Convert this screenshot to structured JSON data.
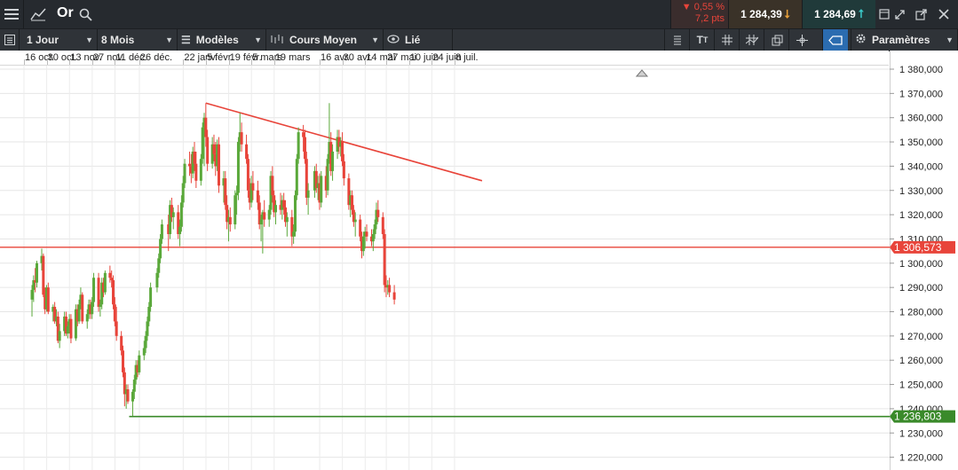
{
  "header": {
    "instrument": "Or",
    "change_pct": "▼ 0,55 %",
    "change_pts": "7,2 pts",
    "bid": "1 284,39",
    "ask": "1 284,69"
  },
  "toolbar": {
    "period": "1 Jour",
    "range": "8 Mois",
    "models": "Modèles",
    "price_type": "Cours Moyen",
    "linked": "Lié",
    "settings": "Paramètres"
  },
  "icons": [
    "menu-icon",
    "line-chart-icon",
    "search-icon",
    "popout-icon",
    "arrows-icon",
    "external-icon",
    "close-icon",
    "sidebar-toggle-icon",
    "models-icon",
    "price-type-icon",
    "eye-icon",
    "list-icon",
    "text-icon",
    "grid-icon",
    "indicators-icon",
    "layers-icon",
    "crosshair-icon",
    "label-icon",
    "gear-icon"
  ],
  "dates": [
    "16 oct.",
    "30 oct.",
    "13 nov.",
    "27 nov.",
    "11 déc.",
    "26 déc.",
    "22 janv.",
    "5 févr.",
    "19 févr.",
    "5 mars",
    "19 mars",
    "16 avr.",
    "30 avr.",
    "14 mai",
    "27 mai",
    "10 juin",
    "24 juin",
    "8 juil."
  ],
  "price_labels": [
    "1 380,000",
    "1 370,000",
    "1 360,000",
    "1 350,000",
    "1 340,000",
    "1 330,000",
    "1 320,000",
    "1 310,000",
    "1 300,000",
    "1 290,000",
    "1 280,000",
    "1 270,000",
    "1 260,000",
    "1 250,000",
    "1 240,000",
    "1 230,000",
    "1 220,000"
  ],
  "levels": {
    "resistance_label": "1 306,573",
    "support_label": "1 236,803",
    "resistance_color": "#e8443a",
    "support_color": "#3a8a2a"
  },
  "colors": {
    "up": "#5aa83a",
    "down": "#e8443a"
  },
  "chart_data": {
    "type": "candlestick",
    "period": "1 Jour",
    "ylim": [
      1215,
      1382
    ],
    "horizontal_lines": [
      1306.573,
      1236.803
    ],
    "trendline": {
      "from": [
        "2018-01-25",
        1366
      ],
      "to": [
        "2018-07-14",
        1334
      ]
    },
    "candles": [
      [
        "2017-10-10",
        1285,
        1291,
        1278,
        1289
      ],
      [
        "2017-10-11",
        1289,
        1295,
        1284,
        1293
      ],
      [
        "2017-10-12",
        1293,
        1298,
        1288,
        1292
      ],
      [
        "2017-10-13",
        1292,
        1301,
        1290,
        1300
      ],
      [
        "2017-10-16",
        1300,
        1306,
        1297,
        1303
      ],
      [
        "2017-10-17",
        1303,
        1304,
        1286,
        1287
      ],
      [
        "2017-10-18",
        1287,
        1290,
        1279,
        1281
      ],
      [
        "2017-10-19",
        1281,
        1291,
        1280,
        1290
      ],
      [
        "2017-10-20",
        1290,
        1292,
        1279,
        1280
      ],
      [
        "2017-10-23",
        1280,
        1283,
        1276,
        1282
      ],
      [
        "2017-10-24",
        1282,
        1284,
        1275,
        1276
      ],
      [
        "2017-10-25",
        1276,
        1281,
        1274,
        1278
      ],
      [
        "2017-10-26",
        1278,
        1280,
        1267,
        1268
      ],
      [
        "2017-10-27",
        1268,
        1275,
        1265,
        1272
      ],
      [
        "2017-10-30",
        1272,
        1280,
        1270,
        1278
      ],
      [
        "2017-10-31",
        1278,
        1280,
        1270,
        1271
      ],
      [
        "2017-11-01",
        1271,
        1276,
        1269,
        1274
      ],
      [
        "2017-11-02",
        1274,
        1279,
        1271,
        1277
      ],
      [
        "2017-11-03",
        1277,
        1279,
        1267,
        1269
      ],
      [
        "2017-11-06",
        1269,
        1283,
        1268,
        1281
      ],
      [
        "2017-11-07",
        1281,
        1283,
        1274,
        1276
      ],
      [
        "2017-11-08",
        1276,
        1285,
        1275,
        1283
      ],
      [
        "2017-11-09",
        1283,
        1290,
        1281,
        1287
      ],
      [
        "2017-11-10",
        1287,
        1288,
        1275,
        1276
      ],
      [
        "2017-11-13",
        1276,
        1281,
        1273,
        1279
      ],
      [
        "2017-11-14",
        1279,
        1285,
        1277,
        1283
      ],
      [
        "2017-11-15",
        1283,
        1285,
        1277,
        1279
      ],
      [
        "2017-11-16",
        1279,
        1286,
        1277,
        1284
      ],
      [
        "2017-11-17",
        1284,
        1296,
        1282,
        1294
      ],
      [
        "2017-11-20",
        1294,
        1296,
        1280,
        1282
      ],
      [
        "2017-11-21",
        1282,
        1285,
        1278,
        1283
      ],
      [
        "2017-11-22",
        1283,
        1294,
        1281,
        1292
      ],
      [
        "2017-11-23",
        1292,
        1294,
        1286,
        1288
      ],
      [
        "2017-11-24",
        1288,
        1297,
        1287,
        1296
      ],
      [
        "2017-11-27",
        1296,
        1299,
        1292,
        1294
      ],
      [
        "2017-11-28",
        1294,
        1297,
        1290,
        1293
      ],
      [
        "2017-11-29",
        1293,
        1295,
        1281,
        1283
      ],
      [
        "2017-11-30",
        1283,
        1286,
        1274,
        1276
      ],
      [
        "2017-12-01",
        1276,
        1282,
        1268,
        1270
      ],
      [
        "2017-12-04",
        1270,
        1272,
        1262,
        1264
      ],
      [
        "2017-12-05",
        1264,
        1266,
        1253,
        1255
      ],
      [
        "2017-12-06",
        1255,
        1257,
        1241,
        1246
      ],
      [
        "2017-12-07",
        1246,
        1250,
        1240,
        1248
      ],
      [
        "2017-12-08",
        1248,
        1250,
        1242,
        1243
      ],
      [
        "2017-12-11",
        1243,
        1248,
        1237,
        1247
      ],
      [
        "2017-12-12",
        1247,
        1254,
        1244,
        1252
      ],
      [
        "2017-12-13",
        1252,
        1260,
        1250,
        1258
      ],
      [
        "2017-12-14",
        1258,
        1260,
        1253,
        1255
      ],
      [
        "2017-12-15",
        1255,
        1264,
        1254,
        1262
      ],
      [
        "2017-12-18",
        1262,
        1268,
        1260,
        1265
      ],
      [
        "2017-12-19",
        1265,
        1272,
        1263,
        1270
      ],
      [
        "2017-12-20",
        1270,
        1278,
        1268,
        1276
      ],
      [
        "2017-12-21",
        1276,
        1284,
        1274,
        1282
      ],
      [
        "2017-12-22",
        1282,
        1292,
        1280,
        1290
      ],
      [
        "2017-12-26",
        1290,
        1298,
        1288,
        1296
      ],
      [
        "2017-12-27",
        1296,
        1304,
        1294,
        1302
      ],
      [
        "2017-12-28",
        1302,
        1312,
        1300,
        1310
      ],
      [
        "2017-12-29",
        1310,
        1318,
        1308,
        1316
      ],
      [
        "2018-01-02",
        1316,
        1320,
        1305,
        1312
      ],
      [
        "2018-01-03",
        1312,
        1326,
        1310,
        1324
      ],
      [
        "2018-01-04",
        1324,
        1327,
        1317,
        1319
      ],
      [
        "2018-01-05",
        1319,
        1323,
        1314,
        1321
      ],
      [
        "2018-01-08",
        1321,
        1324,
        1310,
        1312
      ],
      [
        "2018-01-09",
        1312,
        1318,
        1307,
        1315
      ],
      [
        "2018-01-10",
        1315,
        1328,
        1313,
        1325
      ],
      [
        "2018-01-11",
        1325,
        1336,
        1323,
        1333
      ],
      [
        "2018-01-12",
        1333,
        1343,
        1331,
        1341
      ],
      [
        "2018-01-15",
        1341,
        1346,
        1336,
        1340
      ],
      [
        "2018-01-16",
        1340,
        1345,
        1333,
        1337
      ],
      [
        "2018-01-17",
        1337,
        1348,
        1335,
        1346
      ],
      [
        "2018-01-18",
        1346,
        1350,
        1338,
        1341
      ],
      [
        "2018-01-19",
        1341,
        1346,
        1331,
        1334
      ],
      [
        "2018-01-22",
        1334,
        1345,
        1332,
        1343
      ],
      [
        "2018-01-23",
        1343,
        1358,
        1341,
        1356
      ],
      [
        "2018-01-24",
        1356,
        1362,
        1340,
        1360
      ],
      [
        "2018-01-25",
        1360,
        1366,
        1348,
        1352
      ],
      [
        "2018-01-26",
        1352,
        1355,
        1338,
        1341
      ],
      [
        "2018-01-29",
        1341,
        1352,
        1339,
        1349
      ],
      [
        "2018-01-30",
        1349,
        1353,
        1342,
        1345
      ],
      [
        "2018-01-31",
        1345,
        1350,
        1336,
        1340
      ],
      [
        "2018-02-01",
        1340,
        1351,
        1338,
        1349
      ],
      [
        "2018-02-02",
        1349,
        1352,
        1329,
        1332
      ],
      [
        "2018-02-05",
        1332,
        1338,
        1325,
        1335
      ],
      [
        "2018-02-06",
        1335,
        1338,
        1322,
        1324
      ],
      [
        "2018-02-07",
        1324,
        1328,
        1314,
        1317
      ],
      [
        "2018-02-08",
        1317,
        1322,
        1309,
        1319
      ],
      [
        "2018-02-09",
        1319,
        1323,
        1313,
        1316
      ],
      [
        "2018-02-12",
        1316,
        1330,
        1314,
        1328
      ],
      [
        "2018-02-13",
        1328,
        1332,
        1320,
        1329
      ],
      [
        "2018-02-14",
        1329,
        1352,
        1326,
        1350
      ],
      [
        "2018-02-15",
        1350,
        1362,
        1346,
        1354
      ],
      [
        "2018-02-16",
        1354,
        1358,
        1346,
        1349
      ],
      [
        "2018-02-19",
        1349,
        1353,
        1341,
        1343
      ],
      [
        "2018-02-20",
        1343,
        1345,
        1327,
        1330
      ],
      [
        "2018-02-21",
        1330,
        1335,
        1322,
        1325
      ],
      [
        "2018-02-22",
        1325,
        1336,
        1323,
        1333
      ],
      [
        "2018-02-23",
        1333,
        1338,
        1326,
        1330
      ],
      [
        "2018-02-26",
        1330,
        1334,
        1322,
        1325
      ],
      [
        "2018-02-27",
        1325,
        1328,
        1314,
        1316
      ],
      [
        "2018-02-28",
        1316,
        1320,
        1309,
        1318
      ],
      [
        "2018-03-01",
        1318,
        1322,
        1304,
        1321
      ],
      [
        "2018-03-02",
        1321,
        1326,
        1315,
        1318
      ],
      [
        "2018-03-05",
        1318,
        1324,
        1315,
        1322
      ],
      [
        "2018-03-06",
        1322,
        1338,
        1320,
        1336
      ],
      [
        "2018-03-07",
        1336,
        1340,
        1325,
        1328
      ],
      [
        "2018-03-08",
        1328,
        1330,
        1319,
        1321
      ],
      [
        "2018-03-09",
        1321,
        1326,
        1316,
        1324
      ],
      [
        "2018-03-12",
        1324,
        1329,
        1320,
        1322
      ],
      [
        "2018-03-13",
        1322,
        1328,
        1318,
        1326
      ],
      [
        "2018-03-14",
        1326,
        1329,
        1320,
        1323
      ],
      [
        "2018-03-15",
        1323,
        1326,
        1315,
        1317
      ],
      [
        "2018-03-16",
        1317,
        1321,
        1311,
        1319
      ],
      [
        "2018-03-19",
        1319,
        1322,
        1307,
        1311
      ],
      [
        "2018-03-20",
        1311,
        1316,
        1308,
        1313
      ],
      [
        "2018-03-21",
        1313,
        1330,
        1311,
        1328
      ],
      [
        "2018-03-22",
        1328,
        1345,
        1326,
        1343
      ],
      [
        "2018-03-23",
        1343,
        1356,
        1341,
        1354
      ],
      [
        "2018-03-26",
        1354,
        1357,
        1346,
        1352
      ],
      [
        "2018-03-27",
        1352,
        1355,
        1341,
        1343
      ],
      [
        "2018-03-28",
        1343,
        1346,
        1324,
        1327
      ],
      [
        "2018-03-29",
        1327,
        1333,
        1320,
        1330
      ],
      [
        "2018-04-02",
        1330,
        1340,
        1327,
        1338
      ],
      [
        "2018-04-03",
        1338,
        1341,
        1329,
        1331
      ],
      [
        "2018-04-04",
        1331,
        1336,
        1326,
        1333
      ],
      [
        "2018-04-05",
        1333,
        1337,
        1322,
        1325
      ],
      [
        "2018-04-06",
        1325,
        1338,
        1323,
        1336
      ],
      [
        "2018-04-09",
        1336,
        1340,
        1327,
        1330
      ],
      [
        "2018-04-10",
        1330,
        1345,
        1328,
        1343
      ],
      [
        "2018-04-11",
        1343,
        1366,
        1341,
        1350
      ],
      [
        "2018-04-12",
        1350,
        1354,
        1336,
        1338
      ],
      [
        "2018-04-13",
        1338,
        1349,
        1334,
        1346
      ],
      [
        "2018-04-16",
        1346,
        1355,
        1343,
        1352
      ],
      [
        "2018-04-17",
        1352,
        1355,
        1345,
        1348
      ],
      [
        "2018-04-18",
        1348,
        1352,
        1344,
        1350
      ],
      [
        "2018-04-19",
        1350,
        1354,
        1340,
        1342
      ],
      [
        "2018-04-20",
        1342,
        1345,
        1332,
        1335
      ],
      [
        "2018-04-23",
        1335,
        1337,
        1322,
        1324
      ],
      [
        "2018-04-24",
        1324,
        1330,
        1319,
        1328
      ],
      [
        "2018-04-25",
        1328,
        1330,
        1320,
        1322
      ],
      [
        "2018-04-26",
        1322,
        1324,
        1315,
        1317
      ],
      [
        "2018-04-27",
        1317,
        1321,
        1311,
        1318
      ],
      [
        "2018-04-30",
        1318,
        1320,
        1309,
        1311
      ],
      [
        "2018-05-01",
        1311,
        1313,
        1302,
        1305
      ],
      [
        "2018-05-02",
        1305,
        1313,
        1303,
        1311
      ],
      [
        "2018-05-03",
        1311,
        1315,
        1306,
        1313
      ],
      [
        "2018-05-04",
        1313,
        1316,
        1309,
        1311
      ],
      [
        "2018-05-07",
        1311,
        1314,
        1307,
        1309
      ],
      [
        "2018-05-08",
        1309,
        1314,
        1305,
        1312
      ],
      [
        "2018-05-09",
        1312,
        1318,
        1310,
        1316
      ],
      [
        "2018-05-10",
        1316,
        1325,
        1314,
        1322
      ],
      [
        "2018-05-11",
        1322,
        1326,
        1317,
        1319
      ],
      [
        "2018-05-14",
        1319,
        1321,
        1310,
        1312
      ],
      [
        "2018-05-15",
        1312,
        1314,
        1288,
        1291
      ],
      [
        "2018-05-16",
        1291,
        1295,
        1286,
        1290
      ],
      [
        "2018-05-17",
        1290,
        1293,
        1287,
        1291
      ],
      [
        "2018-05-18",
        1291,
        1294,
        1286,
        1288
      ],
      [
        "2018-05-21",
        1288,
        1291,
        1283,
        1285
      ]
    ]
  }
}
